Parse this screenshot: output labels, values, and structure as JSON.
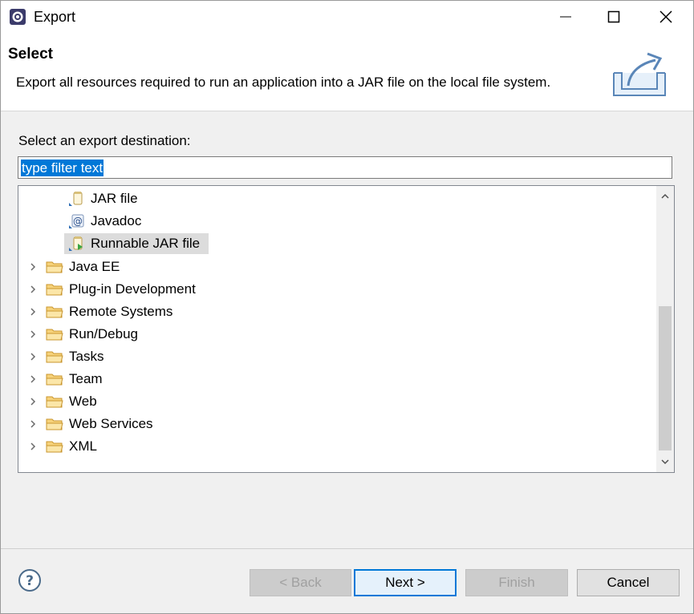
{
  "window": {
    "title": "Export",
    "controls": {
      "minimize": "minimize",
      "maximize": "maximize",
      "close": "close"
    }
  },
  "banner": {
    "title": "Select",
    "description": "Export all resources required to run an application into a JAR file on the local file system.",
    "icon": "export-wizard-icon"
  },
  "destination": {
    "label": "Select an export destination:",
    "filter_value": "type filter text"
  },
  "tree": {
    "sub_items": [
      {
        "label": "JAR file",
        "icon": "jar-file-icon",
        "selected": false
      },
      {
        "label": "Javadoc",
        "icon": "javadoc-icon",
        "selected": false
      },
      {
        "label": "Runnable JAR file",
        "icon": "runnable-jar-icon",
        "selected": true
      }
    ],
    "categories": [
      {
        "label": "Java EE"
      },
      {
        "label": "Plug-in Development"
      },
      {
        "label": "Remote Systems"
      },
      {
        "label": "Run/Debug"
      },
      {
        "label": "Tasks"
      },
      {
        "label": "Team"
      },
      {
        "label": "Web"
      },
      {
        "label": "Web Services"
      },
      {
        "label": "XML"
      }
    ]
  },
  "buttons": {
    "back": "< Back",
    "next": "Next >",
    "finish": "Finish",
    "cancel": "Cancel"
  },
  "colors": {
    "selection": "#0078d7",
    "folder": "#e8b64a",
    "default_button_border": "#0078d7"
  }
}
